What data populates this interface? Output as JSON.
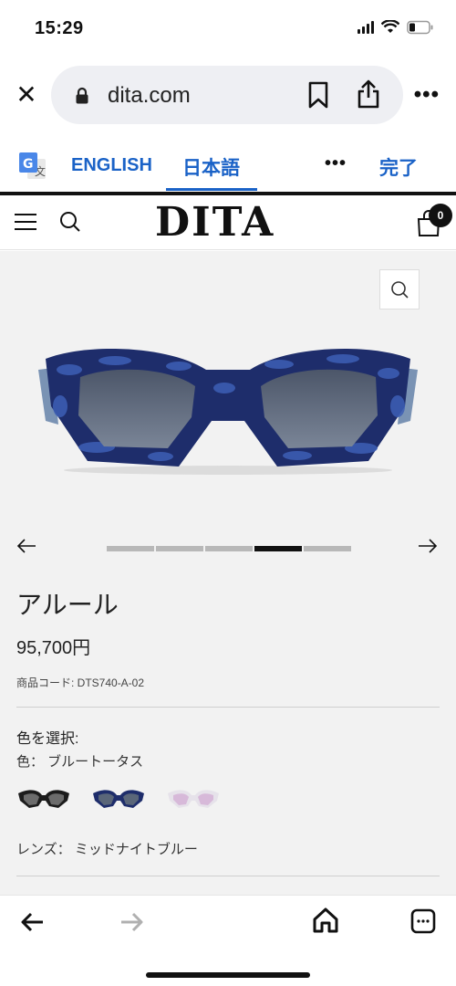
{
  "status": {
    "time": "15:29"
  },
  "browser": {
    "url": "dita.com",
    "more": "•••"
  },
  "translate": {
    "lang_en": "ENGLISH",
    "lang_ja": "日本語",
    "more": "•••",
    "done": "完了"
  },
  "site": {
    "logo": "DITA",
    "cart_count": "0"
  },
  "product": {
    "name": "アルール",
    "price": "95,700円",
    "code": "商品コード: DTS740-A-02",
    "color_select": "色を選択:",
    "color_name": "色： ブルートータス",
    "lens": "レンズ： ミッドナイトブルー",
    "gallery_active_index": 4,
    "gallery_count": 5
  },
  "colors": {
    "accent": "#1a62c7",
    "frame_blue": "#1e2d6b",
    "lens": "#59657a"
  }
}
